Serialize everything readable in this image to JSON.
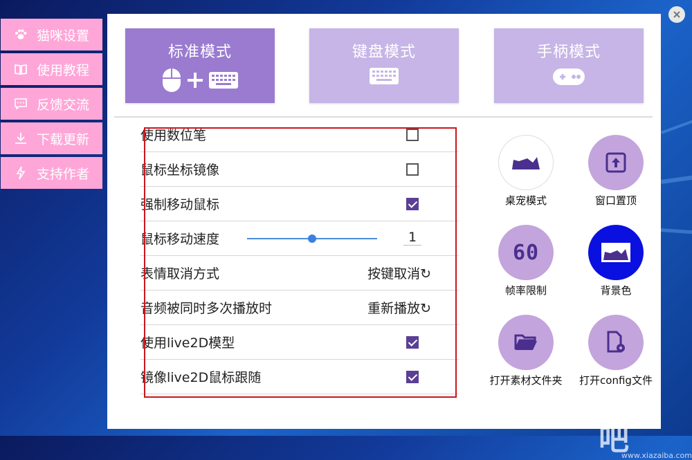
{
  "sidebar": {
    "items": [
      {
        "label": "猫咪设置",
        "icon": "paw-icon"
      },
      {
        "label": "使用教程",
        "icon": "book-icon"
      },
      {
        "label": "反馈交流",
        "icon": "chat-icon"
      },
      {
        "label": "下载更新",
        "icon": "download-icon"
      },
      {
        "label": "支持作者",
        "icon": "lightning-icon"
      }
    ]
  },
  "modes": [
    {
      "label": "标准模式",
      "active": true,
      "icon": "mouse-plus-keyboard-icon"
    },
    {
      "label": "键盘模式",
      "active": false,
      "icon": "keyboard-icon"
    },
    {
      "label": "手柄模式",
      "active": false,
      "icon": "gamepad-icon"
    }
  ],
  "settings": {
    "pen": {
      "label": "使用数位笔",
      "checked": false
    },
    "mirror": {
      "label": "鼠标坐标镜像",
      "checked": false
    },
    "force_move": {
      "label": "强制移动鼠标",
      "checked": true
    },
    "speed": {
      "label": "鼠标移动速度",
      "value": "1",
      "slider_fraction": 0.5
    },
    "emote_cancel": {
      "label": "表情取消方式",
      "value": "按键取消"
    },
    "audio": {
      "label": "音频被同时多次播放时",
      "value": "重新播放"
    },
    "live2d": {
      "label": "使用live2D模型",
      "checked": true
    },
    "live2d_mirror": {
      "label": "镜像live2D鼠标跟随",
      "checked": true
    }
  },
  "actions": [
    {
      "label": "桌宠模式",
      "icon": "desk-pet-icon"
    },
    {
      "label": "窗口置顶",
      "icon": "pin-top-icon"
    },
    {
      "label": "帧率限制",
      "icon": "fps-60-icon",
      "badge": "60"
    },
    {
      "label": "背景色",
      "icon": "background-color-icon"
    },
    {
      "label": "打开素材文件夹",
      "icon": "folder-open-icon"
    },
    {
      "label": "打开config文件",
      "icon": "config-file-icon"
    }
  ],
  "watermark": {
    "big": "下载吧",
    "small": "www.xiazaiba.com"
  },
  "colors": {
    "accent": "#9a7bd0",
    "mode_inactive": "#c6b5e6",
    "sidebar": "#ffa6d8",
    "check": "#5a3f95",
    "highlight_box": "#c8161d"
  }
}
